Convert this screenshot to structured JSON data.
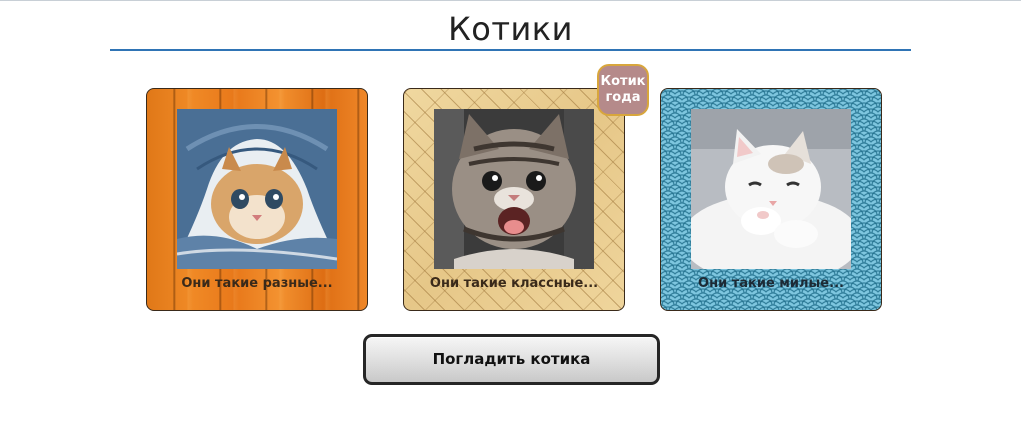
{
  "page": {
    "title": "Котики",
    "accent_color": "#2f74b5"
  },
  "cards": [
    {
      "caption": "Они такие разные...",
      "background": "orange-wood-planks",
      "photo": "kitten-in-denim"
    },
    {
      "caption": "Они такие классные...",
      "background": "tan-parquet",
      "photo": "kitten-open-mouth",
      "badge": [
        "Котик",
        "года"
      ]
    },
    {
      "caption": "Они такие милые...",
      "background": "blue-wave-pattern",
      "photo": "white-kitten-sleepy"
    }
  ],
  "button": {
    "label": "Погладить котика"
  }
}
